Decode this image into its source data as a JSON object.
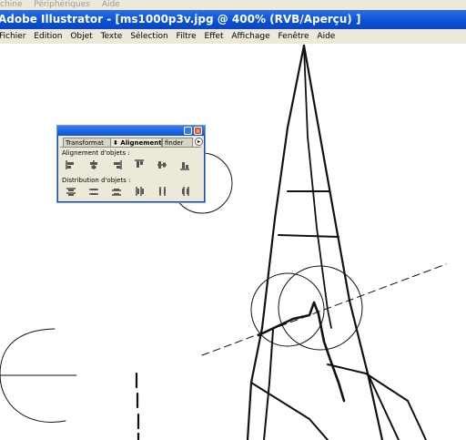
{
  "host_menu": [
    "chine",
    "Périphériques",
    "Aide"
  ],
  "app": {
    "title": "Adobe Illustrator - [ms1000p3v.jpg @ 400% (RVB/Aperçu) ]"
  },
  "menubar": [
    "Fichier",
    "Edition",
    "Objet",
    "Texte",
    "Sélection",
    "Filtre",
    "Effet",
    "Affichage",
    "Fenêtre",
    "Aide"
  ],
  "palette": {
    "tabs": [
      "Transformat",
      "⬍ Alignement",
      "finder"
    ],
    "align_label": "Alignement d'objets :",
    "distribute_label": "Distribution d'objets :",
    "align_icons": [
      "align-left-icon",
      "align-horizontal-center-icon",
      "align-right-icon",
      "align-top-icon",
      "align-vertical-center-icon",
      "align-bottom-icon"
    ],
    "distribute_icons": [
      "distribute-top-icon",
      "distribute-vertical-center-icon",
      "distribute-bottom-icon",
      "distribute-left-icon",
      "distribute-horizontal-center-icon",
      "distribute-right-icon"
    ],
    "minimize_glyph": "_",
    "close_glyph": "×",
    "menu_glyph": "▸"
  }
}
